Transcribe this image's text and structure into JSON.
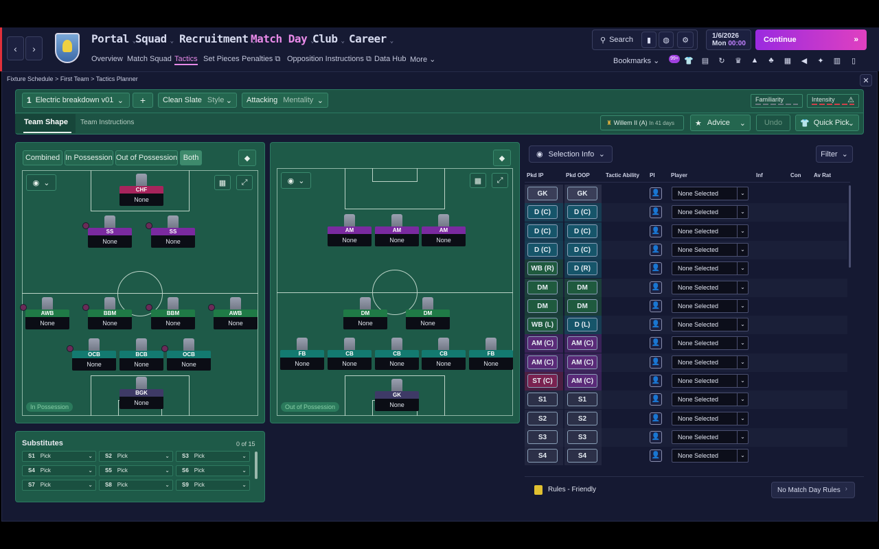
{
  "nav": {
    "main": [
      {
        "label": "Portal"
      },
      {
        "label": "Squad"
      },
      {
        "label": "Recruitment"
      },
      {
        "label": "Match Day"
      },
      {
        "label": "Club"
      },
      {
        "label": "Career"
      }
    ],
    "sub": [
      "Overview",
      "Match Squad",
      "Tactics",
      "Set Pieces",
      "Penalties",
      "Opposition Instructions",
      "Data Hub",
      "More"
    ],
    "search_label": "Search",
    "date": "1/6/2026",
    "day": "Mon",
    "time": "00:00",
    "continue_label": "Continue",
    "bookmarks_label": "Bookmarks",
    "notif_count": "99+"
  },
  "breadcrumb": [
    "Fixture Schedule",
    "First Team",
    "Tactics Planner"
  ],
  "tactic": {
    "slot": "1",
    "name": "Electric breakdown v01",
    "add": "+",
    "style_value": "Clean Slate",
    "style_label": "Style",
    "mentality_value": "Attacking",
    "mentality_label": "Mentality",
    "familiarity": "Familiarity",
    "intensity": "Intensity",
    "tabs": [
      "Team Shape",
      "Team Instructions"
    ],
    "next_opponent": "Willem II (A)",
    "next_opponent_when": "In 41 days",
    "advice": "Advice",
    "undo": "Undo",
    "quick_pick": "Quick Pick"
  },
  "phase_tabs": [
    "Combined",
    "In Possession",
    "Out of Possession",
    "Both"
  ],
  "in_possession_label": "In Possession",
  "out_possession_label": "Out of Possession",
  "ip_players": [
    {
      "role": "CHF",
      "name": "None",
      "color": "#a8245c"
    },
    {
      "role": "SS",
      "name": "None",
      "color": "#7a2aa0"
    },
    {
      "role": "SS",
      "name": "None",
      "color": "#7a2aa0"
    },
    {
      "role": "AWB",
      "name": "None",
      "color": "#1f7a46"
    },
    {
      "role": "BBM",
      "name": "None",
      "color": "#1f7a46"
    },
    {
      "role": "BBM",
      "name": "None",
      "color": "#1f7a46"
    },
    {
      "role": "AWB",
      "name": "None",
      "color": "#1f7a46"
    },
    {
      "role": "OCB",
      "name": "None",
      "color": "#137a70"
    },
    {
      "role": "BCB",
      "name": "None",
      "color": "#137a70"
    },
    {
      "role": "OCB",
      "name": "None",
      "color": "#137a70"
    },
    {
      "role": "BGK",
      "name": "None",
      "color": "#3e3a66"
    }
  ],
  "oop_players": [
    {
      "role": "AM",
      "name": "None",
      "color": "#7a2aa0"
    },
    {
      "role": "AM",
      "name": "None",
      "color": "#7a2aa0"
    },
    {
      "role": "AM",
      "name": "None",
      "color": "#7a2aa0"
    },
    {
      "role": "DM",
      "name": "None",
      "color": "#1f7a46"
    },
    {
      "role": "DM",
      "name": "None",
      "color": "#1f7a46"
    },
    {
      "role": "FB",
      "name": "None",
      "color": "#137a70"
    },
    {
      "role": "CB",
      "name": "None",
      "color": "#137a70"
    },
    {
      "role": "CB",
      "name": "None",
      "color": "#137a70"
    },
    {
      "role": "CB",
      "name": "None",
      "color": "#137a70"
    },
    {
      "role": "FB",
      "name": "None",
      "color": "#137a70"
    },
    {
      "role": "GK",
      "name": "None",
      "color": "#3e3a66"
    }
  ],
  "substitutes": {
    "title": "Substitutes",
    "count": "0 of 15",
    "slots": [
      {
        "id": "S1",
        "value": "Pick"
      },
      {
        "id": "S2",
        "value": "Pick"
      },
      {
        "id": "S3",
        "value": "Pick"
      },
      {
        "id": "S4",
        "value": "Pick"
      },
      {
        "id": "S5",
        "value": "Pick"
      },
      {
        "id": "S6",
        "value": "Pick"
      },
      {
        "id": "S7",
        "value": "Pick"
      },
      {
        "id": "S8",
        "value": "Pick"
      },
      {
        "id": "S9",
        "value": "Pick"
      }
    ]
  },
  "selection": {
    "view_label": "Selection Info",
    "filter_label": "Filter",
    "columns": [
      "Pkd IP",
      "Pkd OOP",
      "Tactic Ability",
      "PI",
      "Player",
      "Inf",
      "Con",
      "Av Rat"
    ],
    "rows": [
      {
        "ip": "GK",
        "oop": "GK",
        "ipc": "#3a3e58",
        "oopc": "#3a3e58",
        "player": "None Selected"
      },
      {
        "ip": "D (C)",
        "oop": "D (C)",
        "ipc": "#16556a",
        "oopc": "#16556a",
        "player": "None Selected"
      },
      {
        "ip": "D (C)",
        "oop": "D (C)",
        "ipc": "#16556a",
        "oopc": "#16556a",
        "player": "None Selected"
      },
      {
        "ip": "D (C)",
        "oop": "D (C)",
        "ipc": "#16556a",
        "oopc": "#16556a",
        "player": "None Selected"
      },
      {
        "ip": "WB (R)",
        "oop": "D (R)",
        "ipc": "#1f5a3e",
        "oopc": "#16556a",
        "player": "None Selected"
      },
      {
        "ip": "DM",
        "oop": "DM",
        "ipc": "#1f5a3e",
        "oopc": "#1f5a3e",
        "player": "None Selected"
      },
      {
        "ip": "DM",
        "oop": "DM",
        "ipc": "#1f5a3e",
        "oopc": "#1f5a3e",
        "player": "None Selected"
      },
      {
        "ip": "WB (L)",
        "oop": "D (L)",
        "ipc": "#1f5a3e",
        "oopc": "#16556a",
        "player": "None Selected"
      },
      {
        "ip": "AM (C)",
        "oop": "AM (C)",
        "ipc": "#5a2a78",
        "oopc": "#5a2a78",
        "player": "None Selected"
      },
      {
        "ip": "AM (C)",
        "oop": "AM (C)",
        "ipc": "#5a2a78",
        "oopc": "#5a2a78",
        "player": "None Selected"
      },
      {
        "ip": "ST (C)",
        "oop": "AM (C)",
        "ipc": "#7a2250",
        "oopc": "#5a2a78",
        "player": "None Selected"
      },
      {
        "ip": "S1",
        "oop": "S1",
        "ipc": "#2c3048",
        "oopc": "#2c3048",
        "player": "None Selected"
      },
      {
        "ip": "S2",
        "oop": "S2",
        "ipc": "#2c3048",
        "oopc": "#2c3048",
        "player": "None Selected"
      },
      {
        "ip": "S3",
        "oop": "S3",
        "ipc": "#2c3048",
        "oopc": "#2c3048",
        "player": "None Selected"
      },
      {
        "ip": "S4",
        "oop": "S4",
        "ipc": "#2c3048",
        "oopc": "#2c3048",
        "player": "None Selected"
      }
    ],
    "rules_label": "Rules - Friendly",
    "match_day_rules": "No Match Day Rules"
  }
}
